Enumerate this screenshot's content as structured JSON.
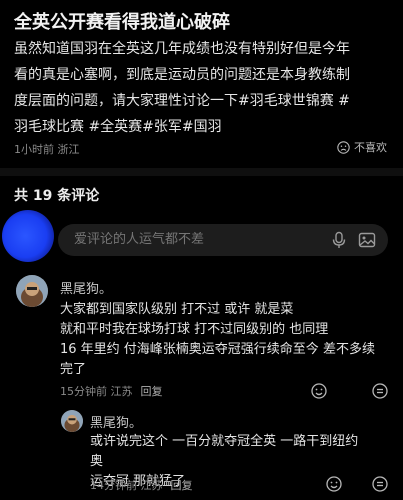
{
  "post": {
    "title": "全英公开赛看得我道心破碎",
    "body_lines": [
      "虽然知道国羽在全英这几年成绩也没有特别好但是今年",
      "看的真是心塞啊，到底是运动员的问题还是本身教练制",
      "度层面的问题，请大家理性讨论一下#羽毛球世锦赛 #",
      "羽毛球比赛 #全英赛#张军#国羽"
    ],
    "meta": "1小时前 浙江",
    "dislike_label": "不喜欢"
  },
  "comments_header": "共 19 条评论",
  "input": {
    "placeholder": "爱评论的人运气都不差"
  },
  "comments": [
    {
      "username": "黑尾狗。",
      "lines": [
        "大家都到国家队级别 打不过 或许 就是菜",
        "就和平时我在球场打球 打不过同级别的 也同理",
        "16 年里约 付海峰张楠奥运夺冠强行续命至今 差不多续",
        "完了"
      ],
      "time_location": "15分钟前 江苏",
      "reply_label": "回复"
    },
    {
      "username": "黑尾狗。",
      "lines": [
        "或许说完这个 一百分就夺冠全英 一路干到纽约奥",
        "运夺冠 那就猛了"
      ],
      "time_location": "14分钟前 江苏",
      "reply_label": "回复"
    }
  ],
  "colors": {
    "background": "#000000",
    "text_primary": "#e8e8e8",
    "text_secondary": "#8a8a8a",
    "input_bg": "#1d1d1d",
    "avatar_blue": "#1a3ef2"
  },
  "icons": [
    "frown-icon",
    "microphone-icon",
    "image-icon",
    "emoji-icon",
    "more-icon"
  ]
}
